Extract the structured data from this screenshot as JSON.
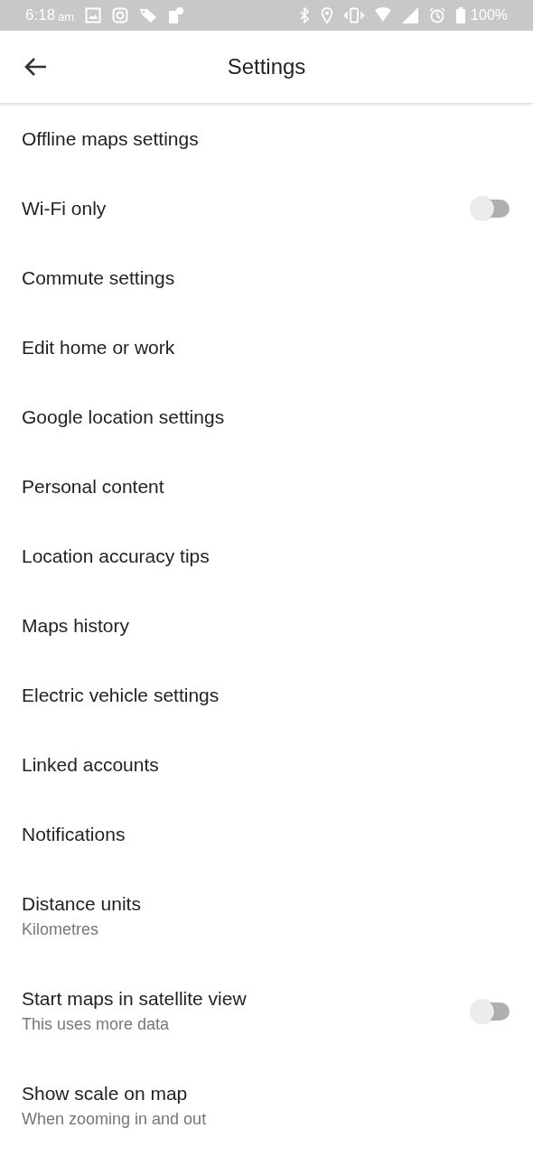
{
  "status_bar": {
    "time": "6:18",
    "ampm": "am",
    "battery": "100%"
  },
  "header": {
    "title": "Settings"
  },
  "items": [
    {
      "kind": "link",
      "title": "Offline maps settings"
    },
    {
      "kind": "toggle",
      "title": "Wi-Fi only",
      "on": false
    },
    {
      "kind": "link",
      "title": "Commute settings"
    },
    {
      "kind": "link",
      "title": "Edit home or work"
    },
    {
      "kind": "link",
      "title": "Google location settings"
    },
    {
      "kind": "link",
      "title": "Personal content"
    },
    {
      "kind": "link",
      "title": "Location accuracy tips"
    },
    {
      "kind": "link",
      "title": "Maps history"
    },
    {
      "kind": "link",
      "title": "Electric vehicle settings"
    },
    {
      "kind": "link",
      "title": "Linked accounts"
    },
    {
      "kind": "link",
      "title": "Notifications"
    },
    {
      "kind": "link",
      "title": "Distance units",
      "subtitle": "Kilometres"
    },
    {
      "kind": "toggle",
      "title": "Start maps in satellite view",
      "subtitle": "This uses more data",
      "on": false
    },
    {
      "kind": "link",
      "title": "Show scale on map",
      "subtitle": "When zooming in and out"
    }
  ]
}
